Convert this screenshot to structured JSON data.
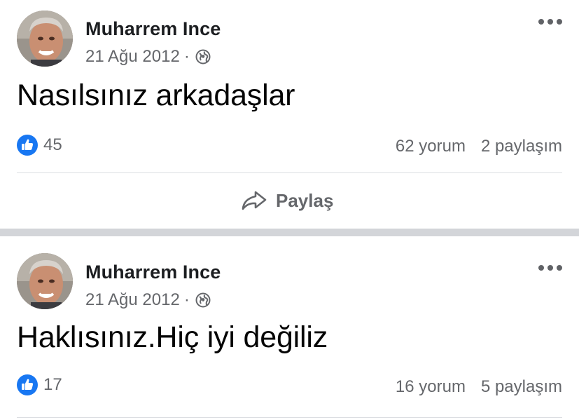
{
  "colors": {
    "text_primary": "#1c1e21",
    "text_secondary": "#65676b",
    "like_blue": "#1877f2",
    "separator": "#d3d5d9"
  },
  "posts": [
    {
      "author": "Muharrem Ince",
      "date": "21 Ağu 2012",
      "separator_dot": "·",
      "privacy_icon": "globe-icon",
      "text": "Nasılsınız arkadaşlar",
      "likes": "45",
      "comments": "62 yorum",
      "shares": "2 paylaşım",
      "share_label": "Paylaş"
    },
    {
      "author": "Muharrem Ince",
      "date": "21 Ağu 2012",
      "separator_dot": "·",
      "privacy_icon": "globe-icon",
      "text": "Haklısınız.Hiç iyi değiliz",
      "likes": "17",
      "comments": "16 yorum",
      "shares": "5 paylaşım"
    }
  ]
}
